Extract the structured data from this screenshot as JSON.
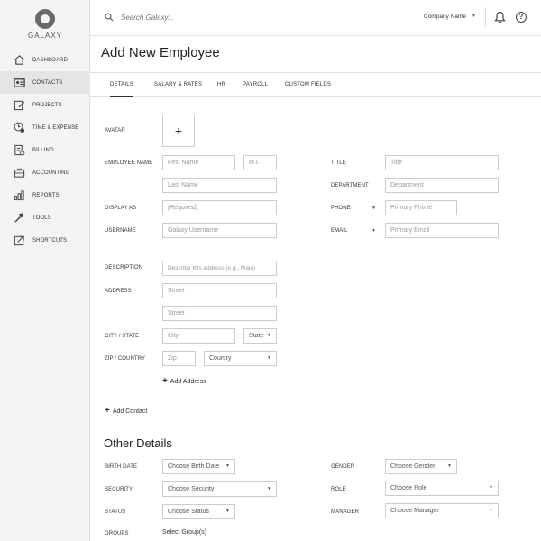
{
  "logo": {
    "text": "GALAXY"
  },
  "sidebar": {
    "items": [
      {
        "label": "DASHBOARD",
        "icon": "home-icon"
      },
      {
        "label": "CONTACTS",
        "icon": "contacts-card-icon",
        "active": true
      },
      {
        "label": "PROJECTS",
        "icon": "projects-edit-icon"
      },
      {
        "label": "TIME & EXPENSE",
        "icon": "time-expense-icon"
      },
      {
        "label": "BILLING",
        "icon": "billing-icon"
      },
      {
        "label": "ACCOUNTING",
        "icon": "briefcase-icon"
      },
      {
        "label": "REPORTS",
        "icon": "bar-chart-icon"
      },
      {
        "label": "TOOLS",
        "icon": "hammer-icon"
      },
      {
        "label": "SHORTCUTS",
        "icon": "external-link-icon"
      }
    ]
  },
  "header": {
    "search_placeholder": "Search Galaxy...",
    "company": "Company Name"
  },
  "page": {
    "title": "Add New Employee"
  },
  "tabs": [
    {
      "label": "DETAILS",
      "active": true
    },
    {
      "label": "SALARY & RATES"
    },
    {
      "label": "HR"
    },
    {
      "label": "PAYROLL"
    },
    {
      "label": "CUSTOM FIELDS"
    }
  ],
  "form": {
    "avatar_label": "AVATAR",
    "avatar_add": "+",
    "employee_name_label": "EMPLOYEE NAME",
    "first_name_ph": "First Name",
    "mi_ph": "M.I.",
    "last_name_ph": "Last Name",
    "display_as_label": "DISPLAY AS",
    "display_as_ph": "(Required)",
    "username_label": "USERNAME",
    "username_ph": "Galaxy Username",
    "title_label": "TITLE",
    "title_ph": "Title",
    "department_label": "DEPARTMENT",
    "department_ph": "Department",
    "phone_label": "PHONE",
    "phone_ph": "Primary Phone",
    "email_label": "EMAIL",
    "email_ph": "Primary Email",
    "description_label": "DESCRIPTION",
    "description_ph": "Describe this address (e.g., Main)",
    "address_label": "ADDRESS",
    "street_ph": "Street",
    "street2_ph": "Street",
    "city_state_label": "CITY / STATE",
    "city_ph": "City",
    "state_value": "State",
    "zip_country_label": "ZIP / COUNTRY",
    "zip_ph": "Zip",
    "country_value": "Country",
    "add_address": "Add Address",
    "add_contact": "Add Contact"
  },
  "other": {
    "title": "Other Details",
    "birth_date_label": "BIRTH DATE",
    "birth_date_value": "Choose Birth Date",
    "gender_label": "GENDER",
    "gender_value": "Choose Gender",
    "security_label": "SECURITY",
    "security_value": "Choose Security",
    "role_label": "ROLE",
    "role_value": "Choose Role",
    "status_label": "STATUS",
    "status_value": "Choose Status",
    "manager_label": "MANAGER",
    "manager_value": "Choose Manager",
    "groups_label": "GROUPS",
    "groups_value": "Select Group(s)"
  }
}
